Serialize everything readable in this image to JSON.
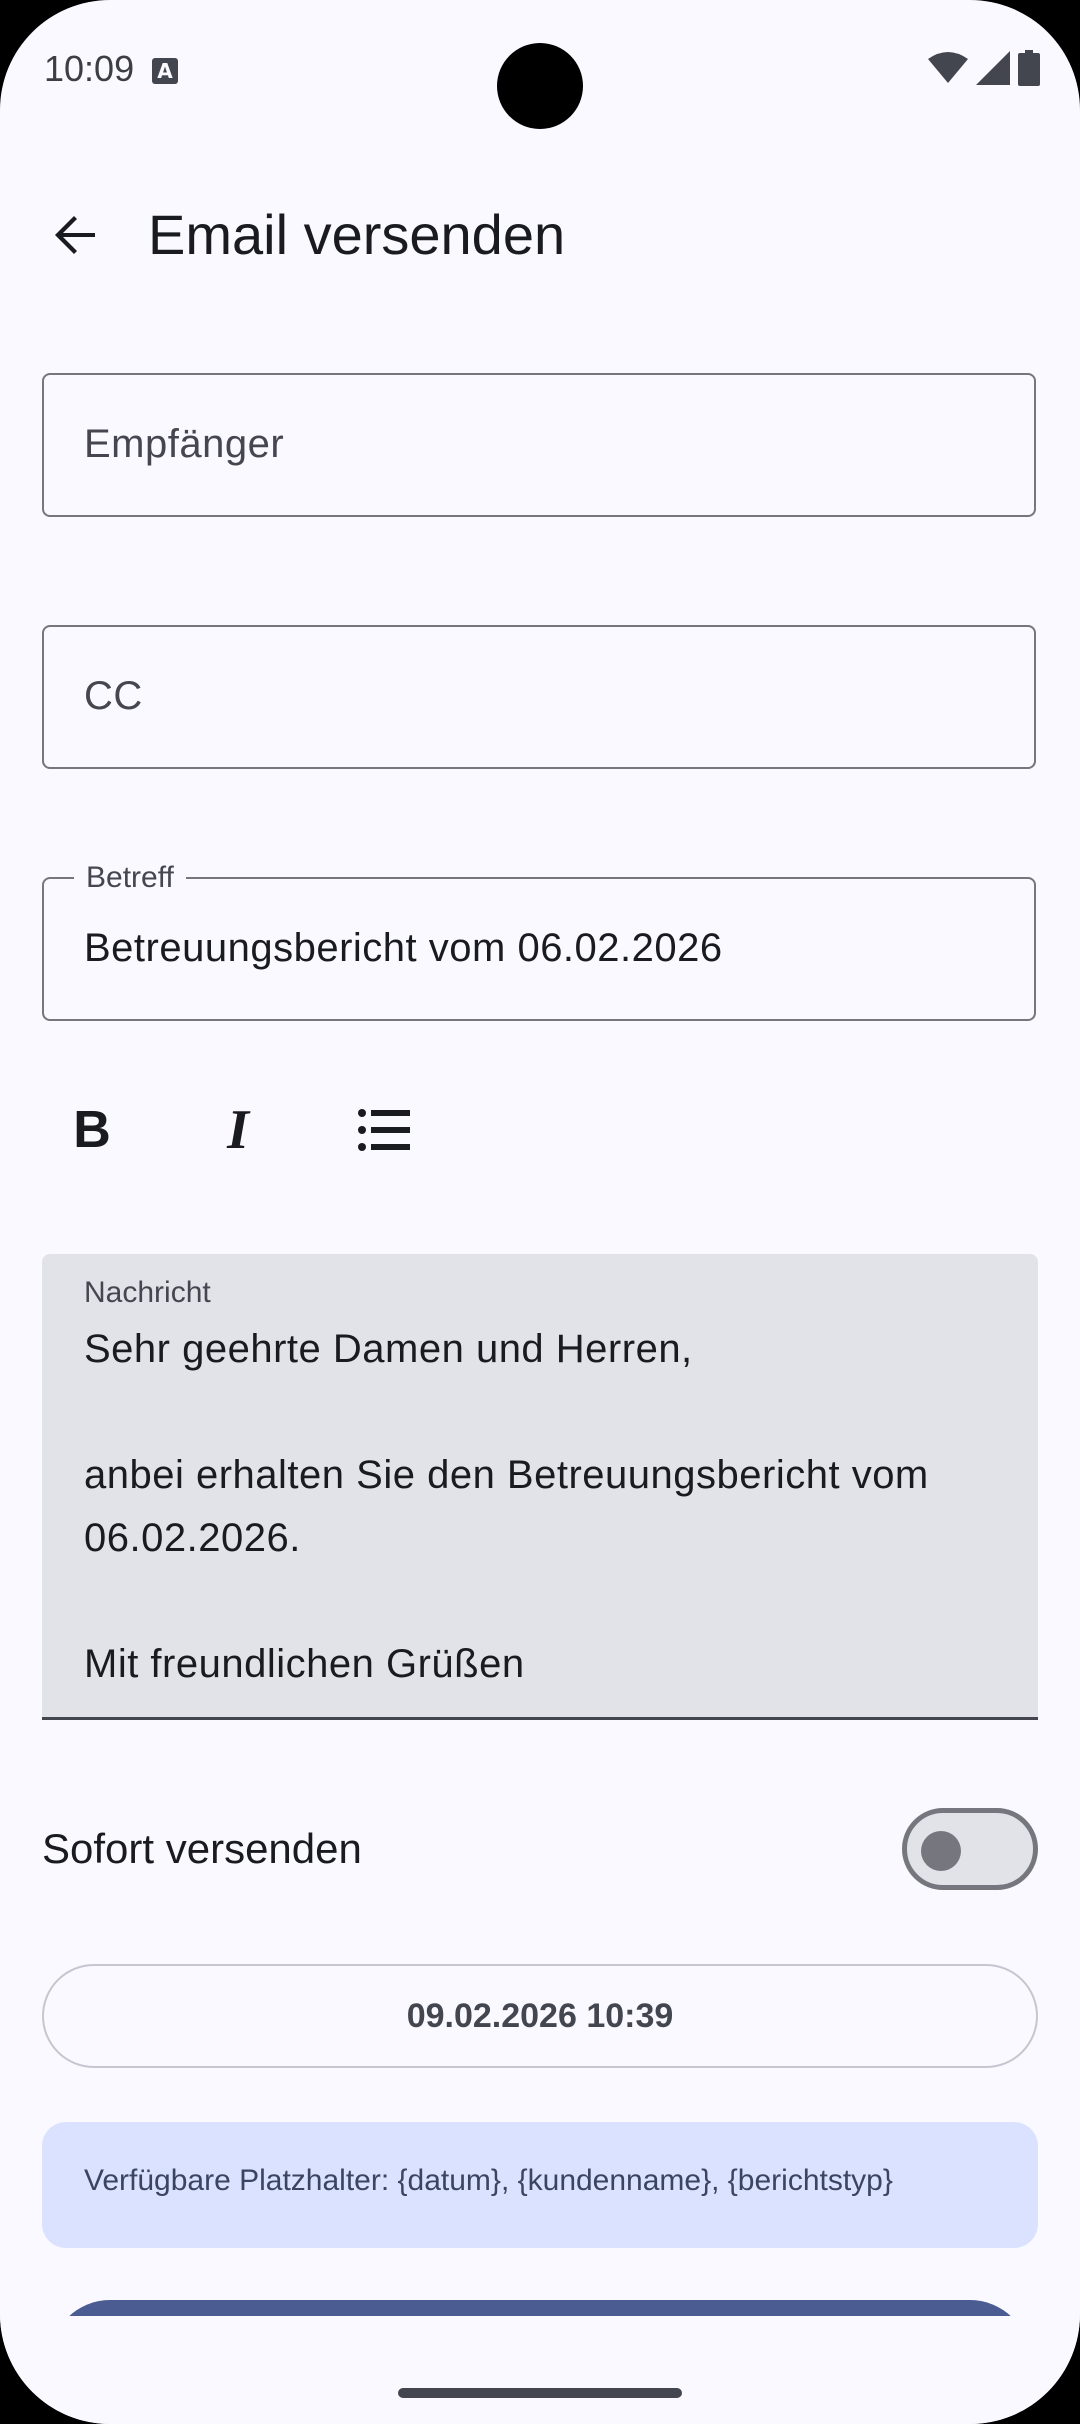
{
  "status_bar": {
    "time": "10:09",
    "notification_icon": "A",
    "icons": [
      "wifi-icon",
      "signal-icon",
      "battery-icon"
    ]
  },
  "top_bar": {
    "title": "Email versenden",
    "back_icon": "arrow-left-icon"
  },
  "form": {
    "recipient": {
      "placeholder": "Empfänger",
      "value": ""
    },
    "cc": {
      "placeholder": "CC",
      "value": ""
    },
    "subject": {
      "label": "Betreff",
      "value": "Betreuungsbericht vom 06.02.2026"
    }
  },
  "formatting": {
    "bold_label": "B",
    "italic_label": "I",
    "list_icon": "bulleted-list-icon"
  },
  "message": {
    "label": "Nachricht",
    "text": "Sehr geehrte Damen und Herren,\n\nanbei erhalten Sie den Betreuungsbericht vom 06.02.2026.\n\nMit freundlichen Grüßen"
  },
  "send_now": {
    "label": "Sofort versenden",
    "enabled": false
  },
  "schedule": {
    "datetime": "09.02.2026 10:39"
  },
  "placeholders_info": {
    "text": "Verfügbare Platzhalter: {datum}, {kundenname}, {berichtstyp}"
  },
  "colors": {
    "background": "#f9f9ff",
    "primary": "#4a5c92",
    "info_container": "#dae2ff",
    "message_container": "#e2e2e9",
    "outline": "#76767f"
  }
}
